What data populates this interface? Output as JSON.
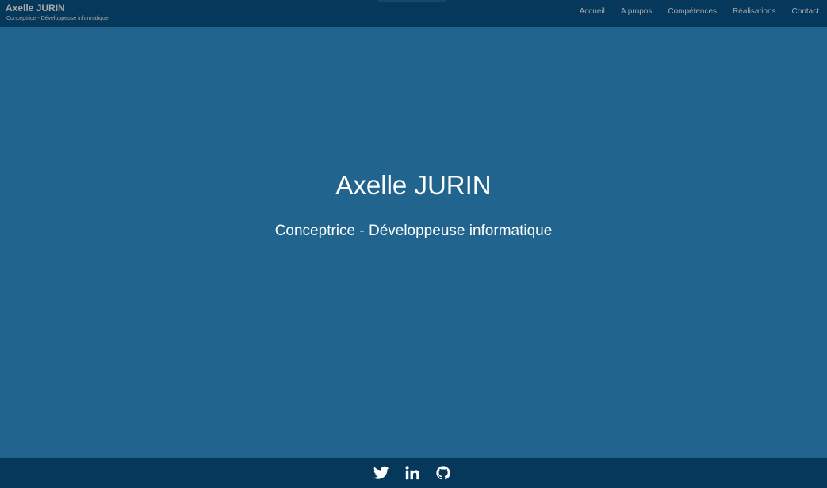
{
  "header": {
    "brand_name": "Axelle JURIN",
    "brand_tagline": "Conceptrice - Développeuse informatique",
    "nav": [
      {
        "label": "Accueil"
      },
      {
        "label": "A propos"
      },
      {
        "label": "Compétences"
      },
      {
        "label": "Réalisations"
      },
      {
        "label": "Contact"
      }
    ]
  },
  "hero": {
    "title": "Axelle JURIN",
    "subtitle": "Conceptrice - Développeuse informatique"
  },
  "footer": {
    "social": [
      {
        "icon": "twitter-icon"
      },
      {
        "icon": "linkedin-icon"
      },
      {
        "icon": "github-icon"
      }
    ]
  },
  "colors": {
    "background": "#21648e",
    "navbar": "#05385a",
    "nav_text": "#a9a9a9",
    "hero_text": "#ffffff"
  }
}
